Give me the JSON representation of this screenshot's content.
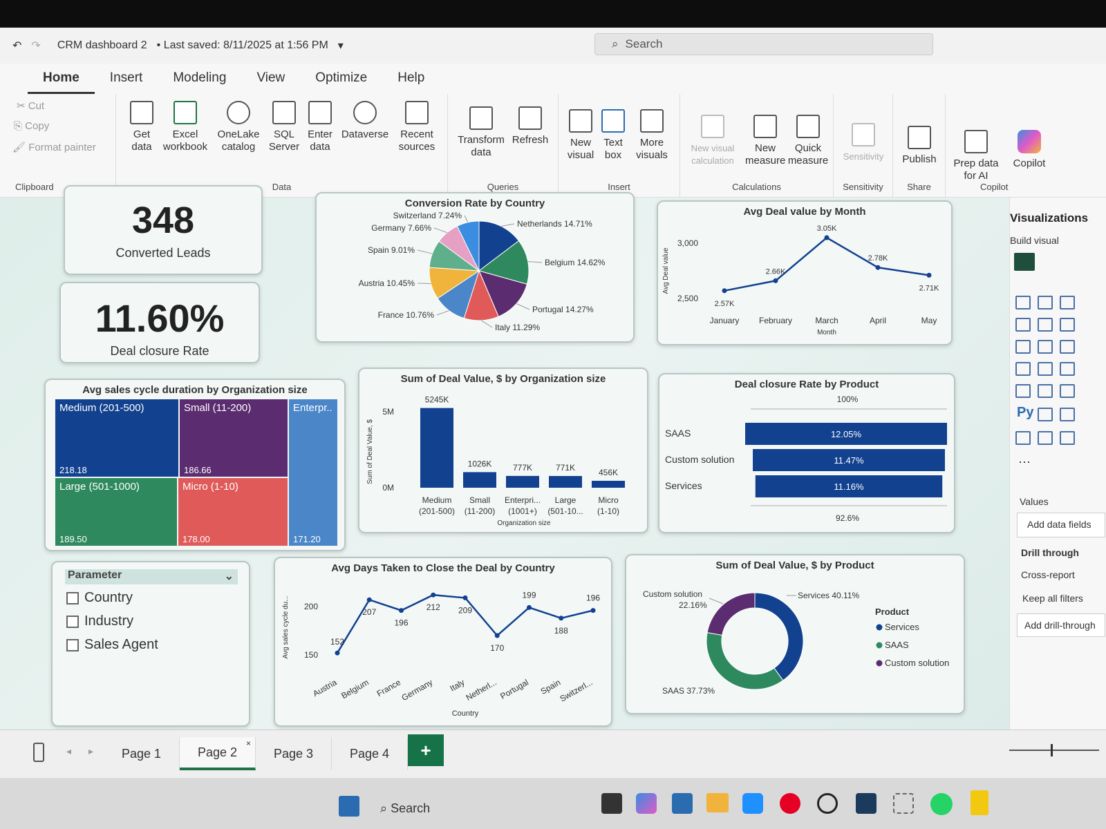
{
  "titlebar": {
    "title": "CRM dashboard 2",
    "saved": "• Last saved: 8/11/2025 at 1:56 PM",
    "search": "Search"
  },
  "tabs": [
    "Home",
    "Insert",
    "Modeling",
    "View",
    "Optimize",
    "Help"
  ],
  "ribbon": {
    "clipboard": {
      "cut": "Cut",
      "copy": "Copy",
      "format_painter": "Format painter",
      "label": "Clipboard"
    },
    "data": {
      "get_data": "Get data",
      "excel": "Excel workbook",
      "onelake": "OneLake catalog",
      "sql": "SQL Server",
      "enter": "Enter data",
      "dataverse": "Dataverse",
      "recent": "Recent sources",
      "label": "Data"
    },
    "queries": {
      "transform": "Transform data",
      "refresh": "Refresh",
      "label": "Queries"
    },
    "insert": {
      "new_visual": "New visual",
      "text_box": "Text box",
      "more_visuals": "More visuals",
      "label": "Insert"
    },
    "calculations": {
      "new_visual_calc": "New visual calculation",
      "new_measure": "New measure",
      "quick_measure": "Quick measure",
      "label": "Calculations"
    },
    "sensitivity": {
      "btn": "Sensitivity",
      "label": "Sensitivity"
    },
    "share": {
      "publish": "Publish",
      "label": "Share"
    },
    "copilot": {
      "prep": "Prep data for AI",
      "copilot": "Copilot",
      "label": "Copilot"
    }
  },
  "kpis": [
    {
      "value": "348",
      "label": "Converted Leads"
    },
    {
      "value": "11.60%",
      "label": "Deal closure Rate"
    }
  ],
  "pie": {
    "title": "Conversion Rate by Country",
    "slices": [
      {
        "label": "Netherlands 14.71%",
        "value": 14.71,
        "color": "#12418f"
      },
      {
        "label": "Belgium 14.62%",
        "value": 14.62,
        "color": "#2e8a5e"
      },
      {
        "label": "Portugal 14.27%",
        "value": 14.27,
        "color": "#5b2c6f"
      },
      {
        "label": "Italy 11.29%",
        "value": 11.29,
        "color": "#e05a5a"
      },
      {
        "label": "France 10.76%",
        "value": 10.76,
        "color": "#4a86c8"
      },
      {
        "label": "Austria 10.45%",
        "value": 10.45,
        "color": "#f0b43c"
      },
      {
        "label": "Spain 9.01%",
        "value": 9.01,
        "color": "#5fae8c"
      },
      {
        "label": "Germany 7.66%",
        "value": 7.66,
        "color": "#e6a0c4"
      },
      {
        "label": "Switzerland 7.24%",
        "value": 7.24,
        "color": "#3a8de0"
      }
    ]
  },
  "line_month": {
    "title": "Avg Deal value by Month",
    "ylabel": "Avg Deal value",
    "xlabel": "Month",
    "yticks": [
      "3,000",
      "2,500"
    ],
    "points": [
      {
        "x": "January",
        "y": 2570,
        "label": "2.57K"
      },
      {
        "x": "February",
        "y": 2660,
        "label": "2.66K"
      },
      {
        "x": "March",
        "y": 3050,
        "label": "3.05K"
      },
      {
        "x": "April",
        "y": 2780,
        "label": "2.78K"
      },
      {
        "x": "May",
        "y": 2710,
        "label": "2.71K"
      }
    ]
  },
  "treemap": {
    "title": "Avg sales cycle duration by Organization size",
    "cells": [
      {
        "name": "Medium (201-500)",
        "value": "218.18",
        "color": "#12418f"
      },
      {
        "name": "Small (11-200)",
        "value": "186.66",
        "color": "#5b2c6f"
      },
      {
        "name": "Enterpr...",
        "value": "171.20",
        "color": "#4a86c8"
      },
      {
        "name": "Large (501-1000)",
        "value": "189.50",
        "color": "#2e8a5e"
      },
      {
        "name": "Micro (1-10)",
        "value": "178.00",
        "color": "#e05a5a"
      }
    ]
  },
  "bar_org": {
    "title": "Sum of Deal Value, $ by Organization size",
    "ylabel": "Sum of Deal Value, $",
    "xlabel": "Organization size",
    "yticks": [
      "5M",
      "0M"
    ],
    "bars": [
      {
        "cat": "Medium (201-500)",
        "value": 5245,
        "label": "5245K"
      },
      {
        "cat": "Small (11-200)",
        "value": 1026,
        "label": "1026K"
      },
      {
        "cat": "Enterpri... (1001+)",
        "value": 777,
        "label": "777K"
      },
      {
        "cat": "Large (501-10...",
        "value": 771,
        "label": "771K"
      },
      {
        "cat": "Micro (1-10)",
        "value": 456,
        "label": "456K"
      }
    ]
  },
  "hbar_product": {
    "title": "Deal closure Rate by Product",
    "top": "100%",
    "bottom": "92.6%",
    "bars": [
      {
        "cat": "SAAS",
        "value": 12.05,
        "label": "12.05%"
      },
      {
        "cat": "Custom solution",
        "value": 11.47,
        "label": "11.47%"
      },
      {
        "cat": "Services",
        "value": 11.16,
        "label": "11.16%"
      }
    ]
  },
  "slicer": {
    "title": "Parameter",
    "items": [
      "Country",
      "Industry",
      "Sales Agent"
    ]
  },
  "line_country": {
    "title": "Avg Days Taken to Close the Deal by Country",
    "ylabel": "Avg sales cycle du...",
    "xlabel": "Country",
    "yticks": [
      "200",
      "150"
    ],
    "points": [
      {
        "x": "Austria",
        "y": 152
      },
      {
        "x": "Belgium",
        "y": 207
      },
      {
        "x": "France",
        "y": 196
      },
      {
        "x": "Germany",
        "y": 212
      },
      {
        "x": "Italy",
        "y": 209
      },
      {
        "x": "Netherl...",
        "y": 170
      },
      {
        "x": "Portugal",
        "y": 199
      },
      {
        "x": "Spain",
        "y": 188
      },
      {
        "x": "Switzerl...",
        "y": 196
      }
    ]
  },
  "donut": {
    "title": "Sum of Deal Value, $ by Product",
    "legend_title": "Product",
    "slices": [
      {
        "name": "Services",
        "value": 40.11,
        "label": "Services 40.11%",
        "color": "#12418f"
      },
      {
        "name": "SAAS",
        "value": 37.73,
        "label": "SAAS 37.73%",
        "color": "#2e8a5e"
      },
      {
        "name": "Custom solution",
        "value": 22.16,
        "label": "Custom solution 22.16%",
        "color": "#5b2c6f"
      }
    ]
  },
  "vizpane": {
    "title": "Visualizations",
    "build": "Build visual",
    "values": "Values",
    "add_field": "Add data fields",
    "drill": "Drill through",
    "cross": "Cross-report",
    "keep": "Keep all filters",
    "add_drill": "Add drill-through"
  },
  "pages": [
    "Page 1",
    "Page 2",
    "Page 3",
    "Page 4"
  ],
  "taskbar": {
    "search": "Search"
  }
}
